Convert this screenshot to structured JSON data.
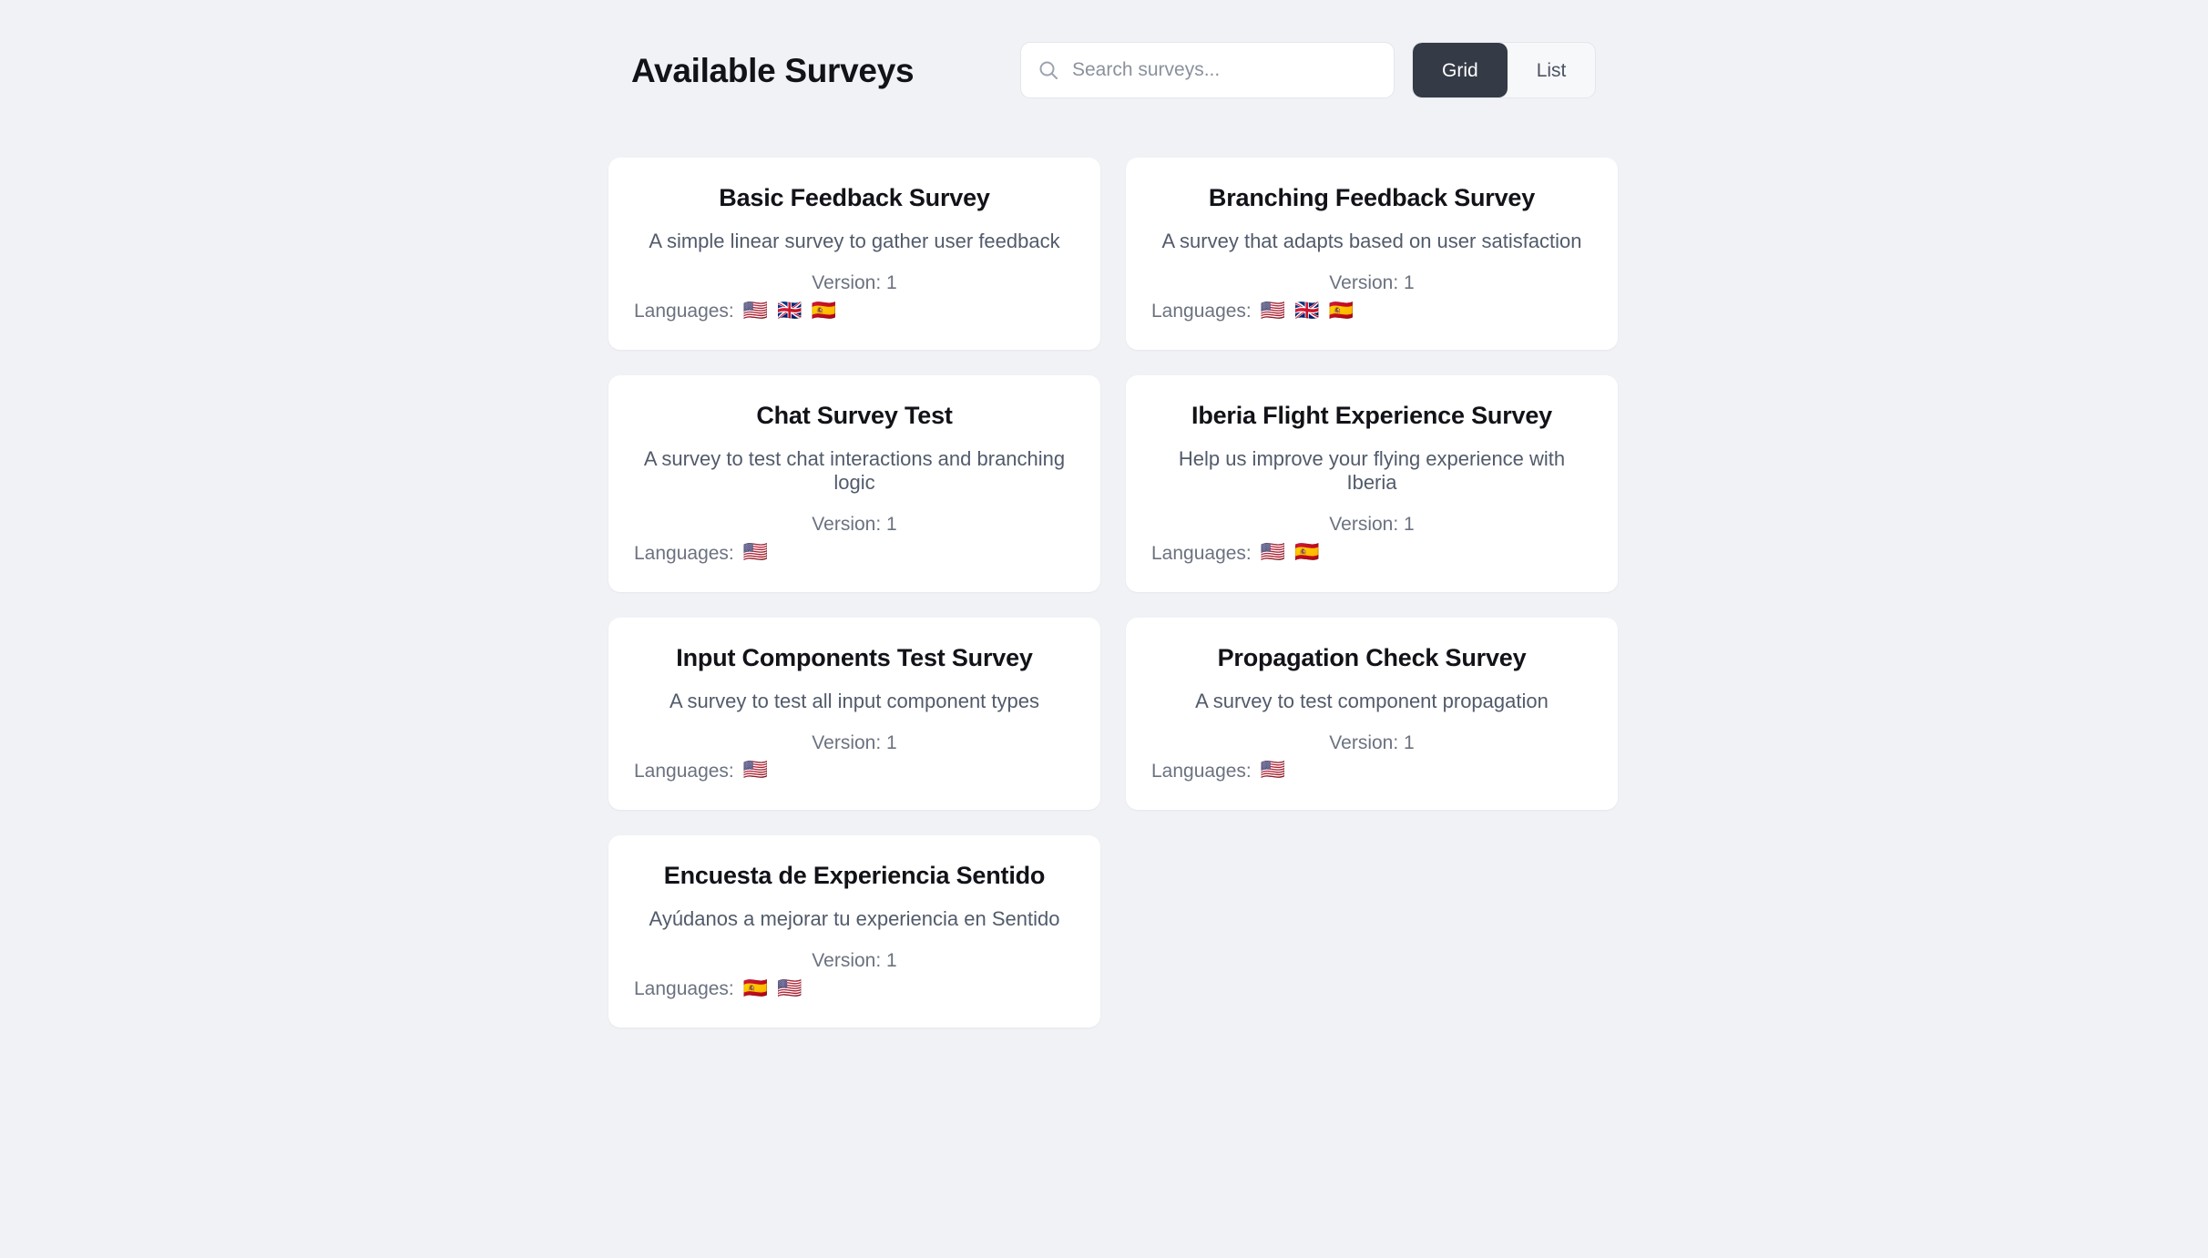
{
  "header": {
    "title": "Available Surveys",
    "search": {
      "placeholder": "Search surveys...",
      "value": "",
      "icon": "search-icon"
    },
    "view_toggle": {
      "active": "Grid",
      "options": [
        "Grid",
        "List"
      ],
      "grid_label": "Grid",
      "list_label": "List"
    }
  },
  "labels": {
    "version_prefix": "Version:",
    "languages_label": "Languages:"
  },
  "colors": {
    "page_background": "#f1f2f6",
    "card_background": "#ffffff",
    "title_text": "#111318",
    "body_text": "#525b6b",
    "muted_text": "#6b7280",
    "toggle_active_background": "#343a46",
    "toggle_active_text": "#ffffff"
  },
  "surveys": [
    {
      "title": "Basic Feedback Survey",
      "description": "A simple linear survey to gather user feedback",
      "version_text": "Version: 1",
      "version": 1,
      "languages_label": "Languages:",
      "languages": [
        "🇺🇸",
        "🇬🇧",
        "🇪🇸"
      ],
      "language_names": [
        "united-states-flag",
        "united-kingdom-flag",
        "spain-flag"
      ]
    },
    {
      "title": "Branching Feedback Survey",
      "description": "A survey that adapts based on user satisfaction",
      "version_text": "Version: 1",
      "version": 1,
      "languages_label": "Languages:",
      "languages": [
        "🇺🇸",
        "🇬🇧",
        "🇪🇸"
      ],
      "language_names": [
        "united-states-flag",
        "united-kingdom-flag",
        "spain-flag"
      ]
    },
    {
      "title": "Chat Survey Test",
      "description": "A survey to test chat interactions and branching logic",
      "version_text": "Version: 1",
      "version": 1,
      "languages_label": "Languages:",
      "languages": [
        "🇺🇸"
      ],
      "language_names": [
        "united-states-flag"
      ]
    },
    {
      "title": "Iberia Flight Experience Survey",
      "description": "Help us improve your flying experience with Iberia",
      "version_text": "Version: 1",
      "version": 1,
      "languages_label": "Languages:",
      "languages": [
        "🇺🇸",
        "🇪🇸"
      ],
      "language_names": [
        "united-states-flag",
        "spain-flag"
      ]
    },
    {
      "title": "Input Components Test Survey",
      "description": "A survey to test all input component types",
      "version_text": "Version: 1",
      "version": 1,
      "languages_label": "Languages:",
      "languages": [
        "🇺🇸"
      ],
      "language_names": [
        "united-states-flag"
      ]
    },
    {
      "title": "Propagation Check Survey",
      "description": "A survey to test component propagation",
      "version_text": "Version: 1",
      "version": 1,
      "languages_label": "Languages:",
      "languages": [
        "🇺🇸"
      ],
      "language_names": [
        "united-states-flag"
      ]
    },
    {
      "title": "Encuesta de Experiencia Sentido",
      "description": "Ayúdanos a mejorar tu experiencia en Sentido",
      "version_text": "Version: 1",
      "version": 1,
      "languages_label": "Languages:",
      "languages": [
        "🇪🇸",
        "🇺🇸"
      ],
      "language_names": [
        "spain-flag",
        "united-states-flag"
      ]
    }
  ]
}
